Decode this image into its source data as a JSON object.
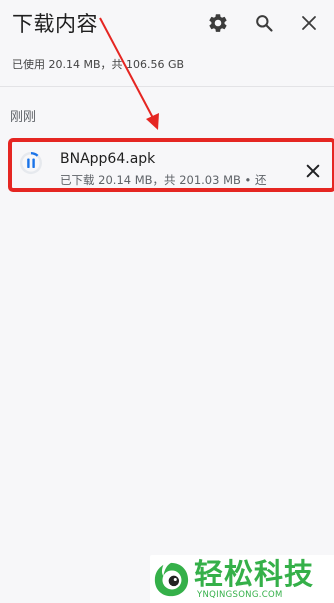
{
  "header": {
    "title": "下载内容",
    "icons": [
      "gear-icon",
      "search-icon",
      "close-icon"
    ]
  },
  "storage": {
    "text": "已使用 20.14 MB，共 106.56 GB"
  },
  "sections": [
    {
      "label": "刚刚",
      "items": [
        {
          "name": "BNApp64.apk",
          "status": "已下载 20.14 MB，共 201.03 MB • 还",
          "icon": "download-progress-pause-icon",
          "progress_fraction": 0.1
        }
      ]
    }
  ],
  "annotation": {
    "highlight_color": "#e52622"
  },
  "watermark": {
    "text": "轻松科技",
    "url": "YNQINGSONG.COM",
    "color": "#35b049"
  }
}
